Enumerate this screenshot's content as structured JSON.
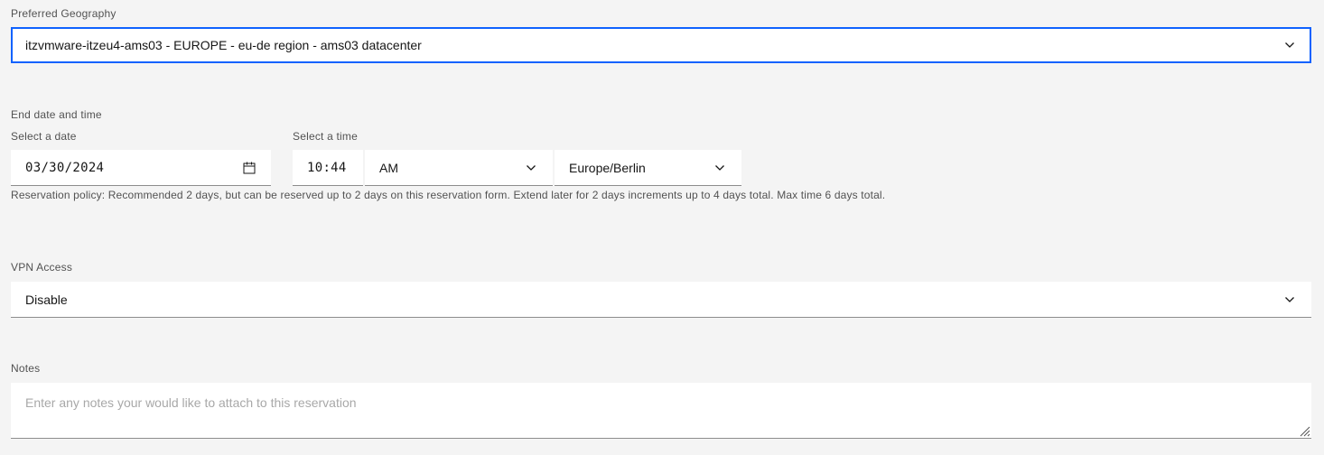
{
  "geography": {
    "label": "Preferred Geography",
    "value": "itzvmware-itzeu4-ams03 - EUROPE - eu-de region - ams03 datacenter"
  },
  "end_datetime": {
    "label": "End date and time",
    "date_label": "Select a date",
    "date_value": "03/30/2024",
    "time_label": "Select a time",
    "time_value": "10:44",
    "ampm_value": "AM",
    "timezone_value": "Europe/Berlin",
    "helper": "Reservation policy: Recommended 2 days, but can be reserved up to 2 days on this reservation form. Extend later for 2 days increments up to 4 days total. Max time 6 days total."
  },
  "vpn": {
    "label": "VPN Access",
    "value": "Disable"
  },
  "notes": {
    "label": "Notes",
    "placeholder": "Enter any notes your would like to attach to this reservation"
  },
  "colors": {
    "background": "#f4f4f4",
    "field_bg": "#ffffff",
    "focus": "#0f62fe",
    "label": "#525252",
    "text": "#161616",
    "placeholder": "#a8a8a8"
  },
  "icons": [
    "chevron-down-icon",
    "calendar-icon",
    "resize-handle-icon"
  ]
}
